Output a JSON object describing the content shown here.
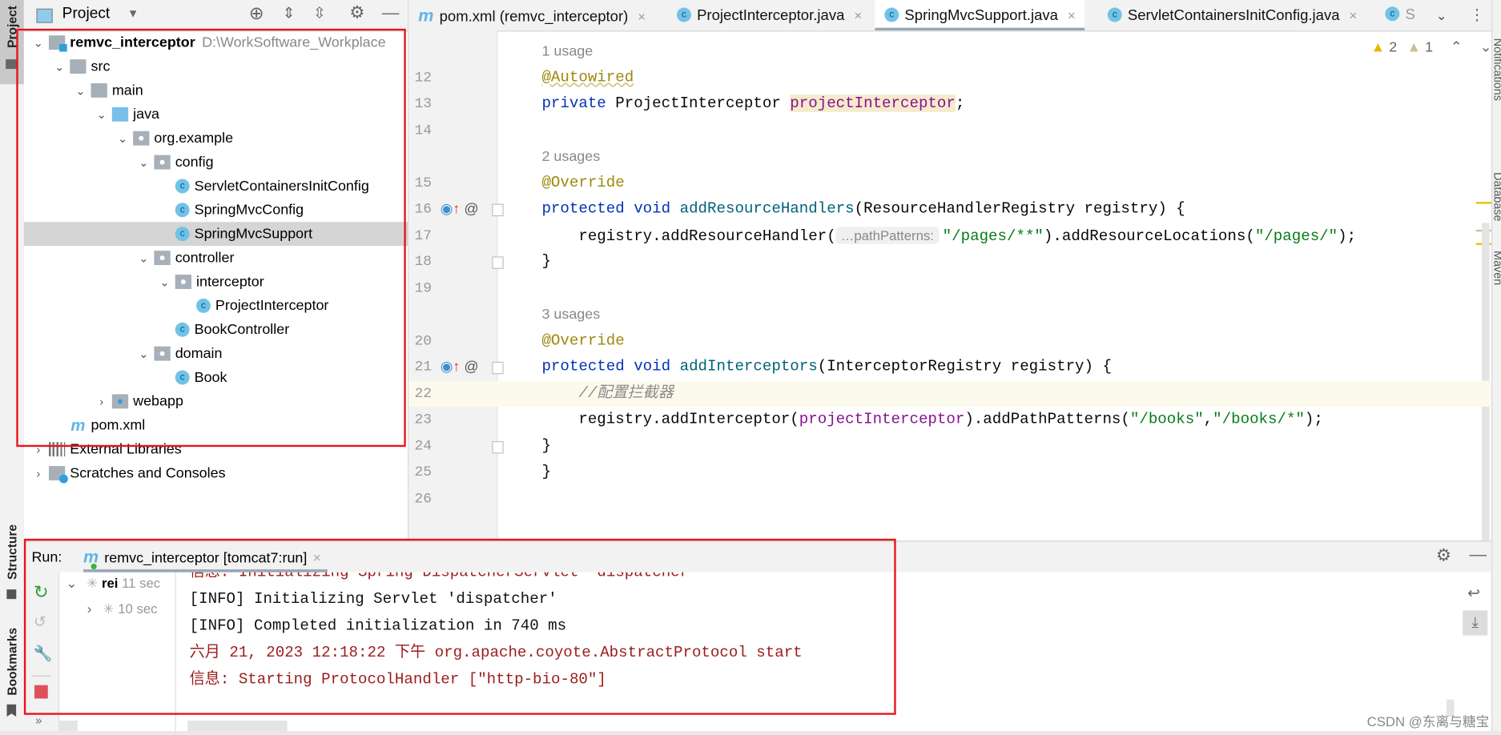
{
  "left_strip": {
    "top_label": "Project",
    "bottom_labels": [
      "Structure",
      "Bookmarks"
    ]
  },
  "right_strip": {
    "labels": [
      "Notifications",
      "Database",
      "Maven"
    ]
  },
  "project": {
    "title": "Project",
    "tree": [
      {
        "depth": 0,
        "chev": "open",
        "icon": "module",
        "label": "remvc_interceptor",
        "bold": true,
        "hint": "D:\\WorkSoftware_Workplace"
      },
      {
        "depth": 1,
        "chev": "open",
        "icon": "folder",
        "label": "src"
      },
      {
        "depth": 2,
        "chev": "open",
        "icon": "folder",
        "label": "main"
      },
      {
        "depth": 3,
        "chev": "open",
        "icon": "folder-blue",
        "label": "java"
      },
      {
        "depth": 4,
        "chev": "open",
        "icon": "pkg",
        "label": "org.example"
      },
      {
        "depth": 5,
        "chev": "open",
        "icon": "pkg",
        "label": "config"
      },
      {
        "depth": 6,
        "chev": "",
        "icon": "class",
        "label": "ServletContainersInitConfig"
      },
      {
        "depth": 6,
        "chev": "",
        "icon": "class",
        "label": "SpringMvcConfig"
      },
      {
        "depth": 6,
        "chev": "",
        "icon": "class",
        "label": "SpringMvcSupport",
        "selected": true
      },
      {
        "depth": 5,
        "chev": "open",
        "icon": "pkg",
        "label": "controller"
      },
      {
        "depth": 6,
        "chev": "open",
        "icon": "pkg",
        "label": "interceptor"
      },
      {
        "depth": 7,
        "chev": "",
        "icon": "class",
        "label": "ProjectInterceptor"
      },
      {
        "depth": 6,
        "chev": "",
        "icon": "class",
        "label": "BookController"
      },
      {
        "depth": 5,
        "chev": "open",
        "icon": "pkg",
        "label": "domain"
      },
      {
        "depth": 6,
        "chev": "",
        "icon": "class",
        "label": "Book"
      },
      {
        "depth": 3,
        "chev": "closed",
        "icon": "webapp",
        "label": "webapp"
      },
      {
        "depth": 1,
        "chev": "",
        "icon": "maven",
        "label": "pom.xml"
      },
      {
        "depth": 0,
        "chev": "closed",
        "icon": "lib",
        "label": "External Libraries"
      },
      {
        "depth": 0,
        "chev": "closed",
        "icon": "scratch",
        "label": "Scratches and Consoles"
      }
    ]
  },
  "editor": {
    "tabs": [
      {
        "icon": "maven",
        "label": "pom.xml (remvc_interceptor)"
      },
      {
        "icon": "class",
        "label": "ProjectInterceptor.java"
      },
      {
        "icon": "class",
        "label": "SpringMvcSupport.java",
        "active": true
      },
      {
        "icon": "class",
        "label": "ServletContainersInitConfig.java"
      },
      {
        "icon": "class",
        "label": "S"
      }
    ],
    "warnings": {
      "count_warn": "2",
      "count_weak": "1"
    },
    "rows": [
      {
        "usage": "1 usage"
      },
      {
        "num": "12",
        "tokens": [
          {
            "c": "ann",
            "t": "@Autowired"
          }
        ]
      },
      {
        "num": "13",
        "tokens": [
          {
            "c": "kw",
            "t": "private "
          },
          {
            "c": "plain",
            "t": "ProjectInterceptor "
          },
          {
            "c": "field-hl",
            "t": "projectInterceptor"
          },
          {
            "c": "plain",
            "t": ";"
          }
        ]
      },
      {
        "num": "14",
        "tokens": []
      },
      {
        "usage": "2 usages"
      },
      {
        "num": "15",
        "tokens": [
          {
            "c": "ann",
            "t": "@Override"
          }
        ]
      },
      {
        "num": "16",
        "icons": true,
        "fold": true,
        "tokens": [
          {
            "c": "kw",
            "t": "protected void "
          },
          {
            "c": "fn",
            "t": "addResourceHandlers"
          },
          {
            "c": "plain",
            "t": "(ResourceHandlerRegistry registry) {"
          }
        ]
      },
      {
        "num": "17",
        "tokens": [
          {
            "c": "plain",
            "t": "    registry.addResourceHandler("
          },
          {
            "c": "hint",
            "t": "…pathPatterns:"
          },
          {
            "c": "str",
            "t": "\"/pages/**\""
          },
          {
            "c": "plain",
            "t": ").addResourceLocations("
          },
          {
            "c": "str",
            "t": "\"/pages/\""
          },
          {
            "c": "plain",
            "t": ");"
          }
        ]
      },
      {
        "num": "18",
        "fold": true,
        "tokens": [
          {
            "c": "plain",
            "t": "}"
          }
        ]
      },
      {
        "num": "19",
        "tokens": []
      },
      {
        "usage": "3 usages"
      },
      {
        "num": "20",
        "tokens": [
          {
            "c": "ann",
            "t": "@Override"
          }
        ]
      },
      {
        "num": "21",
        "icons": true,
        "fold": true,
        "tokens": [
          {
            "c": "kw",
            "t": "protected void "
          },
          {
            "c": "fn",
            "t": "addInterceptors"
          },
          {
            "c": "plain",
            "t": "(InterceptorRegistry registry) {"
          }
        ]
      },
      {
        "num": "22",
        "current": true,
        "tokens": [
          {
            "c": "cm",
            "t": "    //配置拦截器"
          }
        ]
      },
      {
        "num": "23",
        "tokens": [
          {
            "c": "plain",
            "t": "    registry.addInterceptor("
          },
          {
            "c": "field",
            "t": "projectInterceptor"
          },
          {
            "c": "plain",
            "t": ").addPathPatterns("
          },
          {
            "c": "str",
            "t": "\"/books\""
          },
          {
            "c": "plain",
            "t": ","
          },
          {
            "c": "str",
            "t": "\"/books/*\""
          },
          {
            "c": "plain",
            "t": ");"
          }
        ]
      },
      {
        "num": "24",
        "fold": true,
        "tokens": [
          {
            "c": "plain",
            "t": "}"
          }
        ]
      },
      {
        "num": "25",
        "tokens": [
          {
            "c": "plain",
            "t": "}"
          }
        ]
      },
      {
        "num": "26",
        "tokens": []
      }
    ]
  },
  "run": {
    "label": "Run:",
    "tab": "remvc_interceptor [tomcat7:run]",
    "tree": [
      {
        "label": "rei",
        "time": "11 sec"
      },
      {
        "label": "",
        "time": "10 sec"
      }
    ],
    "console": [
      {
        "c": "red",
        "t": "信息: Initializing Spring DispatcherServlet 'dispatcher'"
      },
      {
        "c": "blk",
        "t": "[INFO] Initializing Servlet 'dispatcher'"
      },
      {
        "c": "blk",
        "t": "[INFO] Completed initialization in 740 ms"
      },
      {
        "c": "red",
        "t": "六月 21, 2023 12:18:22 下午 org.apache.coyote.AbstractProtocol start"
      },
      {
        "c": "red",
        "t": "信息: Starting ProtocolHandler [\"http-bio-80\"]"
      }
    ]
  },
  "watermark": "CSDN @东离与糖宝",
  "colors": {
    "highlight_box": "#e8141c",
    "accent": "#6fc3e8"
  }
}
